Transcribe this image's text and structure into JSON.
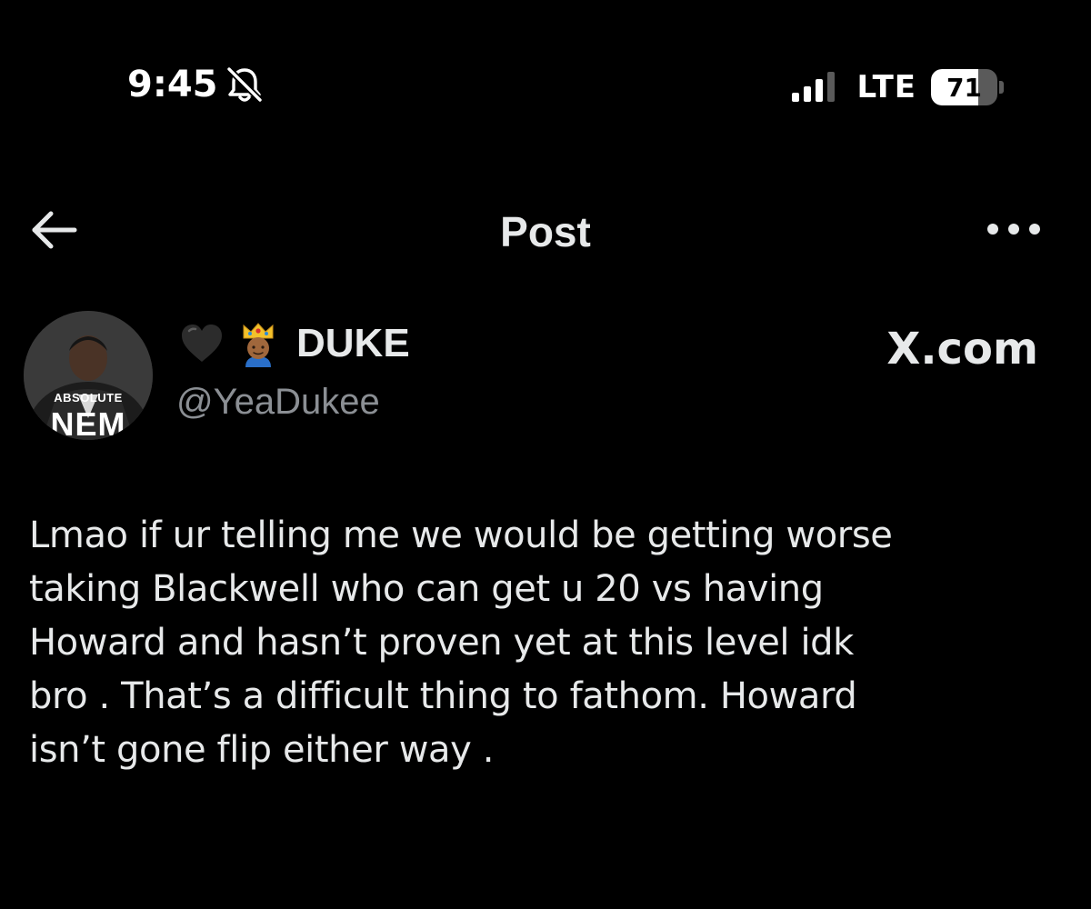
{
  "status_bar": {
    "time": "9:45",
    "network": "LTE",
    "battery_level": "71",
    "battery_fraction": 0.71,
    "icons": [
      "bell-slash-icon",
      "signal-icon",
      "battery-icon"
    ]
  },
  "nav": {
    "title": "Post",
    "icons": [
      "back-arrow-icon",
      "more-icon"
    ]
  },
  "author": {
    "emojis": [
      "black-heart-icon",
      "crown-person-icon"
    ],
    "display_name": "DUKE",
    "handle": "@YeaDukee",
    "avatar_caption": "ABSOLUTE",
    "avatar_brand": "NEM"
  },
  "watermark": "X.com",
  "post": {
    "lines": [
      "Lmao if ur telling me we would be getting worse",
      "taking Blackwell who can get u 20 vs having",
      "Howard and hasn’t proven yet at this level idk",
      "bro . That’s a difficult thing to fathom. Howard",
      "isn’t gone flip either way ."
    ]
  },
  "colors": {
    "background": "#000000",
    "text": "#e7e9ea",
    "secondary_text": "#8b8f94"
  }
}
